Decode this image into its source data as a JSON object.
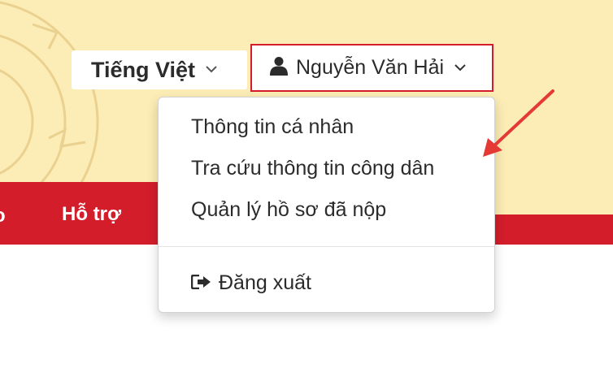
{
  "header": {
    "language_label": "Tiếng Việt",
    "user_name": "Nguyễn Văn Hải"
  },
  "nav": {
    "partial_item": "o",
    "support_label": "Hỗ trợ"
  },
  "dropdown": {
    "items": [
      {
        "label": "Thông tin cá nhân"
      },
      {
        "label": "Tra cứu thông tin công dân"
      },
      {
        "label": "Quản lý hồ sơ đã nộp"
      }
    ],
    "logout_label": "Đăng xuất"
  },
  "icons": {
    "user": "user-icon",
    "logout": "sign-out-icon",
    "chevron": "chevron-down-icon"
  },
  "colors": {
    "brand_red": "#d41d2b",
    "header_bg": "#fcecb5",
    "arrow": "#e53935"
  }
}
